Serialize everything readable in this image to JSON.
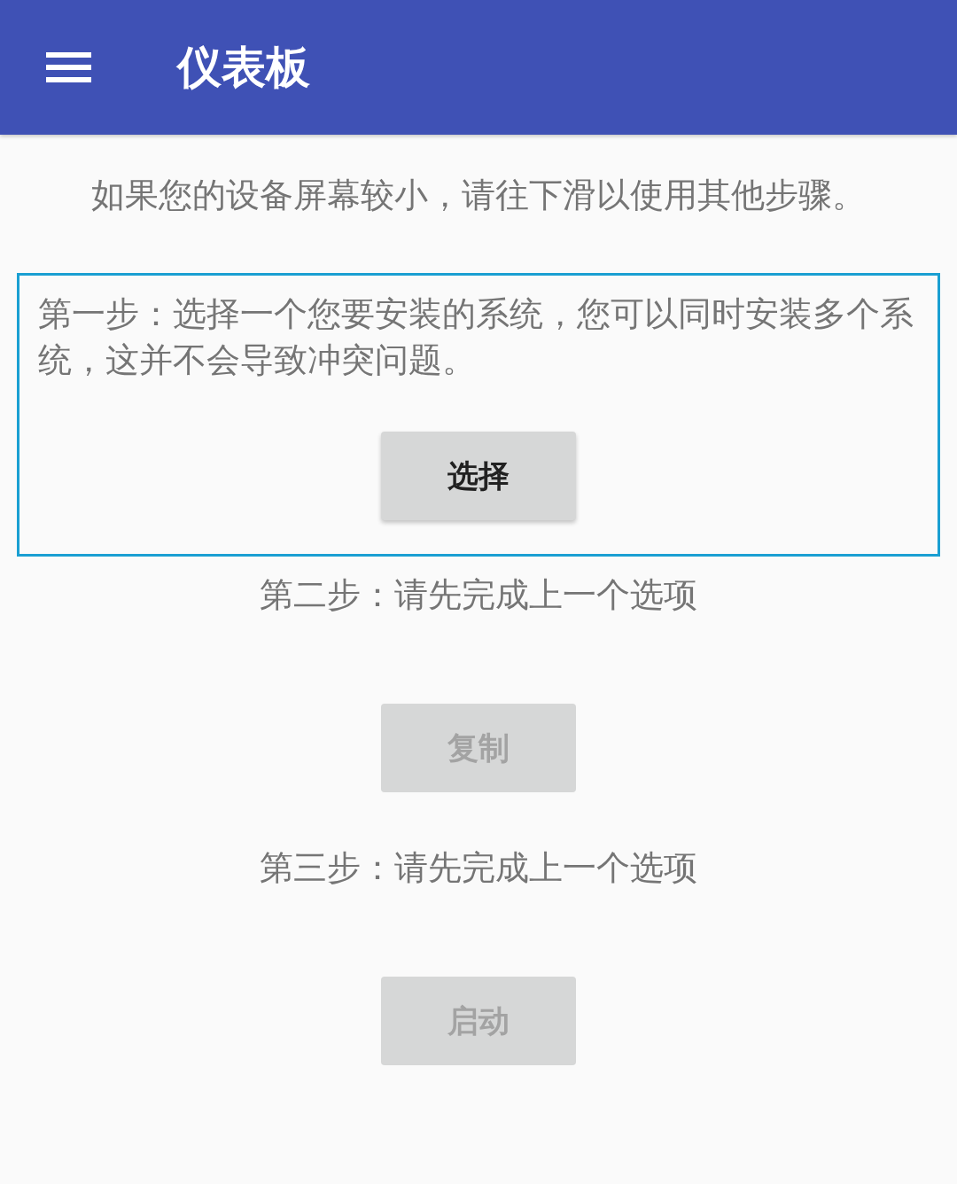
{
  "app_bar": {
    "title": "仪表板"
  },
  "hint": "如果您的设备屏幕较小，请往下滑以使用其他步骤。",
  "steps": [
    {
      "text": "第一步：选择一个您要安装的系统，您可以同时安装多个系统，这并不会导致冲突问题。",
      "active": true,
      "button": {
        "label": "选择",
        "disabled": false
      }
    },
    {
      "text": "第二步：请先完成上一个选项",
      "active": false,
      "button": {
        "label": "复制",
        "disabled": true
      }
    },
    {
      "text": "第三步：请先完成上一个选项",
      "active": false,
      "button": {
        "label": "启动",
        "disabled": true
      }
    }
  ]
}
